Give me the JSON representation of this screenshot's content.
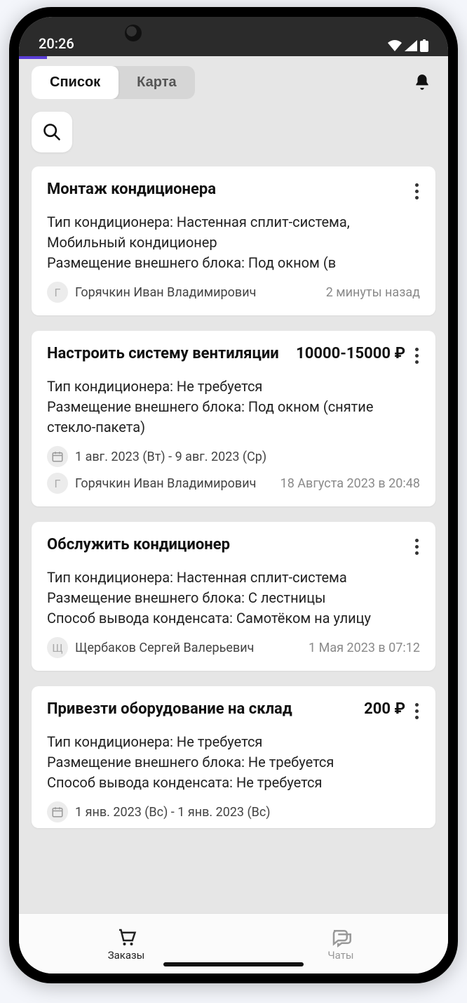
{
  "status": {
    "time": "20:26"
  },
  "tabs": {
    "list": "Список",
    "map": "Карта"
  },
  "cards": [
    {
      "title": "Монтаж кондиционера",
      "price": "",
      "desc": "Тип кондиционера: Настенная сплит-система, Мобильный кондиционер\nРазмещение внешнего блока: Под окном (в",
      "date_range": "",
      "avatar_letter": "Г",
      "author": "Горячкин Иван Владимирович",
      "time": "2 минуты назад"
    },
    {
      "title": "Настроить систему вентиляции",
      "price": "10000-15000 ₽",
      "desc": "Тип кондиционера: Не требуется\nРазмещение внешнего блока: Под окном (снятие стекло-пакета)",
      "date_range": "1 авг. 2023  (Вт) - 9 авг. 2023  (Ср)",
      "avatar_letter": "Г",
      "author": "Горячкин Иван Владимирович",
      "time": "18 Августа 2023 в 20:48"
    },
    {
      "title": "Обслужить кондиционер",
      "price": "",
      "desc": "Тип кондиционера: Настенная сплит-система\nРазмещение внешнего блока: С лестницы\nСпособ вывода конденсата: Самотёком на улицу",
      "date_range": "",
      "avatar_letter": "Щ",
      "author": "Щербаков  Сергей  Валерьевич",
      "time": "1 Мая 2023 в 07:12"
    },
    {
      "title": "Привезти оборудование на склад",
      "price": "200 ₽",
      "desc": "Тип кондиционера: Не требуется\nРазмещение внешнего блока: Не требуется\nСпособ вывода конденсата: Не требуется",
      "date_range": "1 янв. 2023  (Вс) - 1 янв. 2023  (Вс)",
      "avatar_letter": "",
      "author": "",
      "time": ""
    }
  ],
  "nav": {
    "orders": "Заказы",
    "chats": "Чаты"
  }
}
